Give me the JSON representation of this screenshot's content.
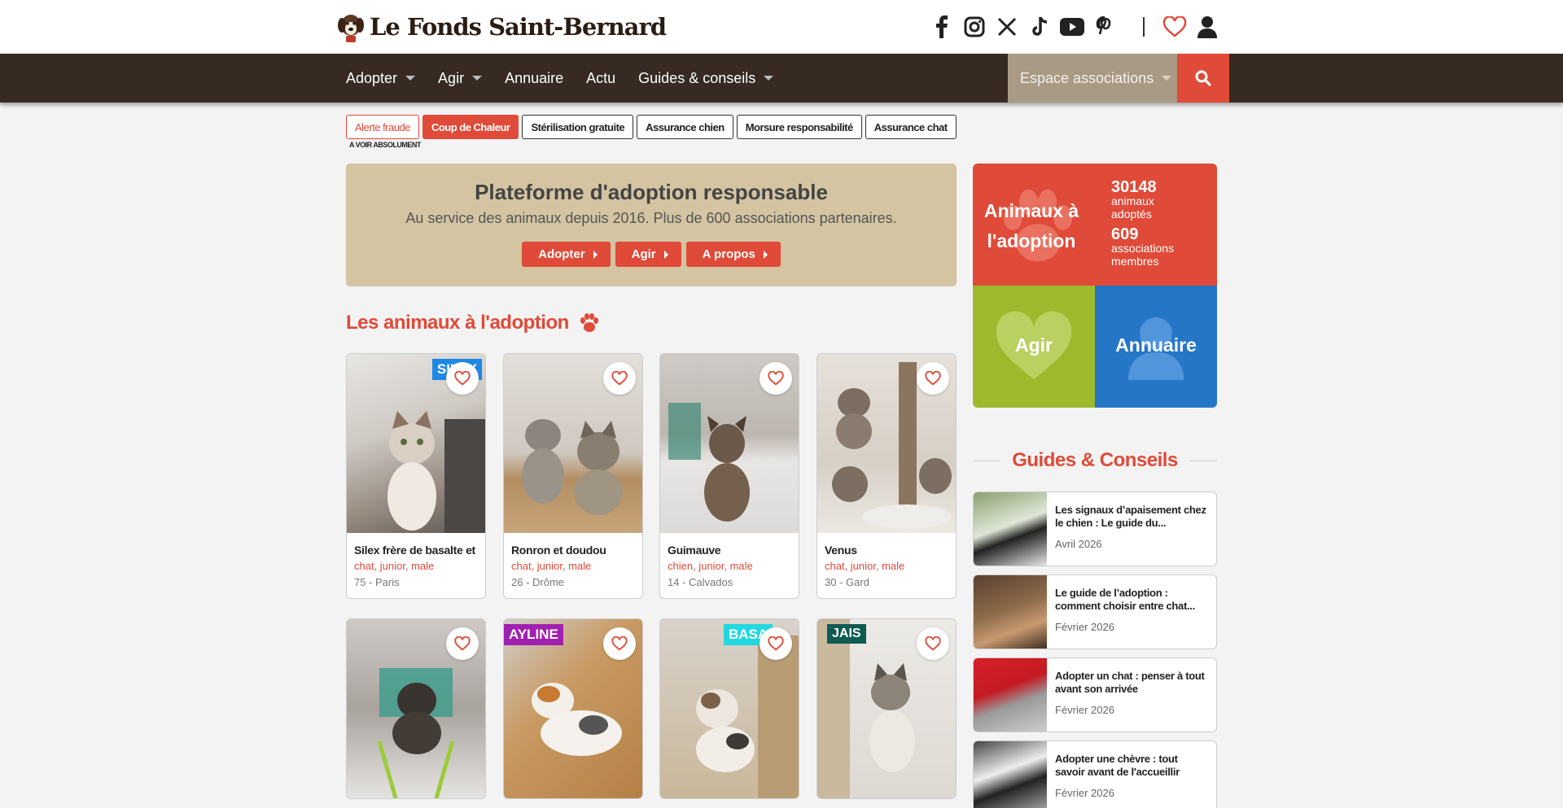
{
  "header": {
    "logo_text": "Le Fonds Saint-Bernard",
    "socials": [
      "facebook-icon",
      "instagram-icon",
      "x-icon",
      "tiktok-icon",
      "youtube-icon",
      "pinterest-icon"
    ]
  },
  "nav": {
    "items": [
      {
        "label": "Adopter",
        "dropdown": true
      },
      {
        "label": "Agir",
        "dropdown": true
      },
      {
        "label": "Annuaire",
        "dropdown": false
      },
      {
        "label": "Actu",
        "dropdown": false
      },
      {
        "label": "Guides & conseils",
        "dropdown": true
      }
    ],
    "espace_label": "Espace associations"
  },
  "pills": {
    "items": [
      "Alerte fraude",
      "Coup de Chaleur",
      "Stérilisation gratuite",
      "Assurance chien",
      "Morsure responsabilité",
      "Assurance chat"
    ],
    "caption": "A VOIR ABSOLUMENT"
  },
  "hero": {
    "title": "Plateforme d'adoption responsable",
    "subtitle": "Au service des animaux depuis 2016. Plus de 600 associations partenaires.",
    "buttons": [
      "Adopter",
      "Agir",
      "A propos"
    ]
  },
  "animals": {
    "title": "Les animaux à l'adoption",
    "cards": [
      {
        "name": "Silex frère de basalte et",
        "meta": "chat, junior, male",
        "loc": "75 - Paris",
        "tag": "SILEX",
        "tag_color": "#1e88e5"
      },
      {
        "name": "Ronron et doudou",
        "meta": "chat, junior, male",
        "loc": "26 - Drôme",
        "tag": "",
        "tag_color": ""
      },
      {
        "name": "Guimauve",
        "meta": "chien, junior, male",
        "loc": "14 - Calvados",
        "tag": "",
        "tag_color": ""
      },
      {
        "name": "Venus",
        "meta": "chat, junior, male",
        "loc": "30 - Gard",
        "tag": "",
        "tag_color": ""
      },
      {
        "name": "",
        "meta": "",
        "loc": "",
        "tag": "",
        "tag_color": ""
      },
      {
        "name": "",
        "meta": "",
        "loc": "",
        "tag": "AYLINE",
        "tag_color": "#a020b0"
      },
      {
        "name": "",
        "meta": "",
        "loc": "",
        "tag": "BASA",
        "tag_color": "#22d8e0"
      },
      {
        "name": "",
        "meta": "",
        "loc": "",
        "tag": "JAIS",
        "tag_color": "#0f5a52"
      }
    ]
  },
  "tiles": {
    "red_label": "Animaux à l'adoption",
    "stat1_num": "30148",
    "stat1_lbl": "animaux adoptés",
    "stat2_num": "609",
    "stat2_lbl": "associations membres",
    "green_label": "Agir",
    "blue_label": "Annuaire"
  },
  "guides": {
    "title": "Guides & Conseils",
    "items": [
      {
        "title": "Les signaux d’apaisement chez le chien : Le guide du...",
        "date": "Avril 2026"
      },
      {
        "title": "Le guide de l’adoption : comment choisir entre chat...",
        "date": "Février 2026"
      },
      {
        "title": "Adopter un chat : penser à tout avant son arrivée",
        "date": "Février 2026"
      },
      {
        "title": "Adopter une chèvre : tout savoir avant de l'accueillir",
        "date": "Février 2026"
      }
    ]
  },
  "colors": {
    "accent": "#e04a38",
    "nav_bg": "#362a22",
    "hero_bg": "#d4c4a2",
    "green": "#9cba2c",
    "blue": "#2576c6"
  }
}
